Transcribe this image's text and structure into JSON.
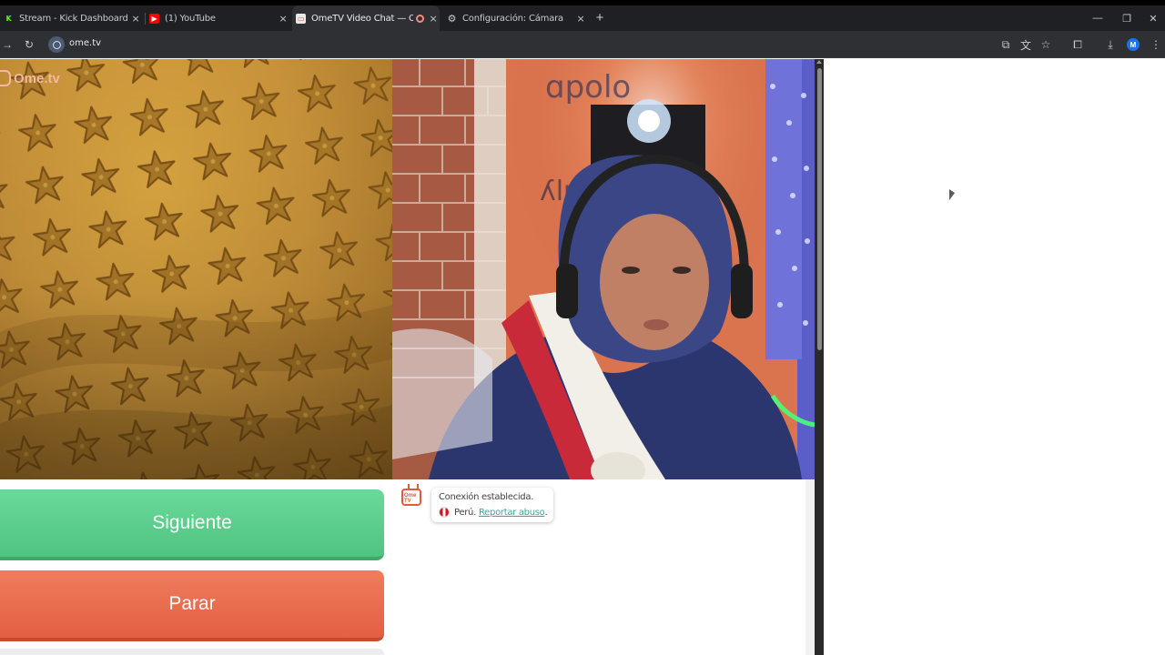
{
  "browser": {
    "tabs": [
      {
        "title": "Stream - Kick Dashboard",
        "favicon": "kick-icon",
        "close": "×"
      },
      {
        "title": "(1) YouTube",
        "favicon": "youtube-icon",
        "close": "×"
      },
      {
        "title": "OmeTV Video Chat — Ome",
        "favicon": "ometv-icon",
        "close": "×"
      },
      {
        "title": "Configuración: Cámara",
        "favicon": "settings-gear-icon",
        "close": "×"
      }
    ],
    "new_tab": "+",
    "url": "ome.tv",
    "profile_initial": "M"
  },
  "page": {
    "logo_text": "Ome.tv",
    "buttons": {
      "next": "Siguiente",
      "stop": "Parar"
    },
    "chat": {
      "avatar_text": "Ome TV",
      "system_message": "Conexión establecida.",
      "country": "Perú.",
      "report_link": "Reportar abuso",
      "report_suffix": "."
    }
  },
  "colors": {
    "next_button": "#4fc47f",
    "stop_button": "#e35f42",
    "link": "#3aa6a0",
    "accent_logo": "#f4b7a2"
  }
}
